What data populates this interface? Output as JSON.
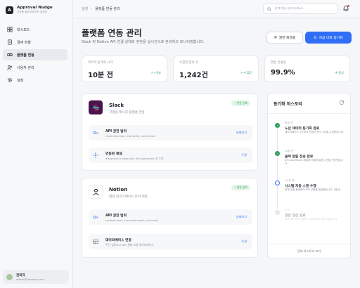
{
  "app": {
    "name": "Approval Nudge",
    "subtitle": "기업용 결재 리마인드 솔루션",
    "logo_glyph": "A"
  },
  "sidebar": {
    "items": [
      {
        "label": "대시보드",
        "icon": "dashboard-icon"
      },
      {
        "label": "결재 현황",
        "icon": "document-icon"
      },
      {
        "label": "플랫폼 연동",
        "icon": "link-icon",
        "active": true
      },
      {
        "label": "사용자 관리",
        "icon": "users-icon"
      },
      {
        "label": "설정",
        "icon": "gear-icon"
      }
    ],
    "user": {
      "name": "관리자",
      "email": "admin@company.com"
    }
  },
  "topbar": {
    "breadcrumb": [
      "설정",
      "플랫폼 연동 관리"
    ],
    "search_placeholder": "검색어를 입력하세요...",
    "notification_icon": "bell-icon"
  },
  "header": {
    "title": "플랫폼 연동 관리",
    "description": "Slack 및 Notion API 연결 상태와 권한을 실시간으로 관리하고 모니터링합니다.",
    "recheck_label": "권한 재검증",
    "sync_label": "지금 바로 동기화"
  },
  "stats": [
    {
      "label": "마지막 동기화 시각",
      "value": "10분 전",
      "delta": "+2분"
    },
    {
      "label": "수집된 문서 수",
      "value": "1,242건",
      "delta": "+12건"
    },
    {
      "label": "연동 안정성",
      "value": "99.9%",
      "delta": "정상"
    }
  ],
  "slack": {
    "name": "Slack",
    "subtitle": "기업용 메시징 플랫폼 연동",
    "badge": "• 연동 완료",
    "rows": [
      {
        "title": "API 권한 범위",
        "sub": "channels:read, chat:write, users:read",
        "link": "상세보기",
        "icon": "key-icon"
      },
      {
        "title": "연동된 채널",
        "sub": "#approval-nudge-bot, #hr-approvals 외 2개",
        "link": "수정",
        "icon": "hash-icon"
      }
    ],
    "brand_color": "#4a154b"
  },
  "notion": {
    "name": "Notion",
    "subtitle": "협업 워크스페이스 문서 연동",
    "badge": "• 연동 완료",
    "rows": [
      {
        "title": "API 권한 범위",
        "sub": "content:read, comment:read, user:read",
        "link": "상세보기",
        "icon": "key-icon"
      },
      {
        "title": "데이터베이스 연동",
        "sub": "주간 업무보고 DB, 결재 요청 데이터베이스",
        "link": "수정",
        "icon": "database-icon"
      }
    ]
  },
  "history": {
    "title": "동기화 히스토리",
    "footer": "전체 히스토리 보기",
    "items": [
      {
        "time": "방금 전",
        "title": "노션 데이터 동기화 완료",
        "desc": "데이터베이스 2곳에서 변경된 문서 3건을 수집했습니다.",
        "status": "done"
      },
      {
        "time": "10분 전",
        "title": "슬랙 알림 전송 완료",
        "desc": "#hr-approvals 채널에 미결재 알림 2건을 전송했습니다.",
        "status": "done"
      },
      {
        "time": "1시간 전",
        "title": "시스템 자동 스캔 수행",
        "desc": "전체 연동 플랫폼의 API 상태를 점검했습니다. (정상)",
        "status": "info"
      },
      {
        "time": "어제",
        "title": "권한 갱신 완료",
        "desc": "슬랙 API 토큰 권한이 성공적으로 갱신되었습니다.",
        "status": "faded"
      }
    ]
  },
  "colors": {
    "accent": "#2f6ef5",
    "success": "#2f9e5a",
    "slack_purple": "#4a154b"
  }
}
